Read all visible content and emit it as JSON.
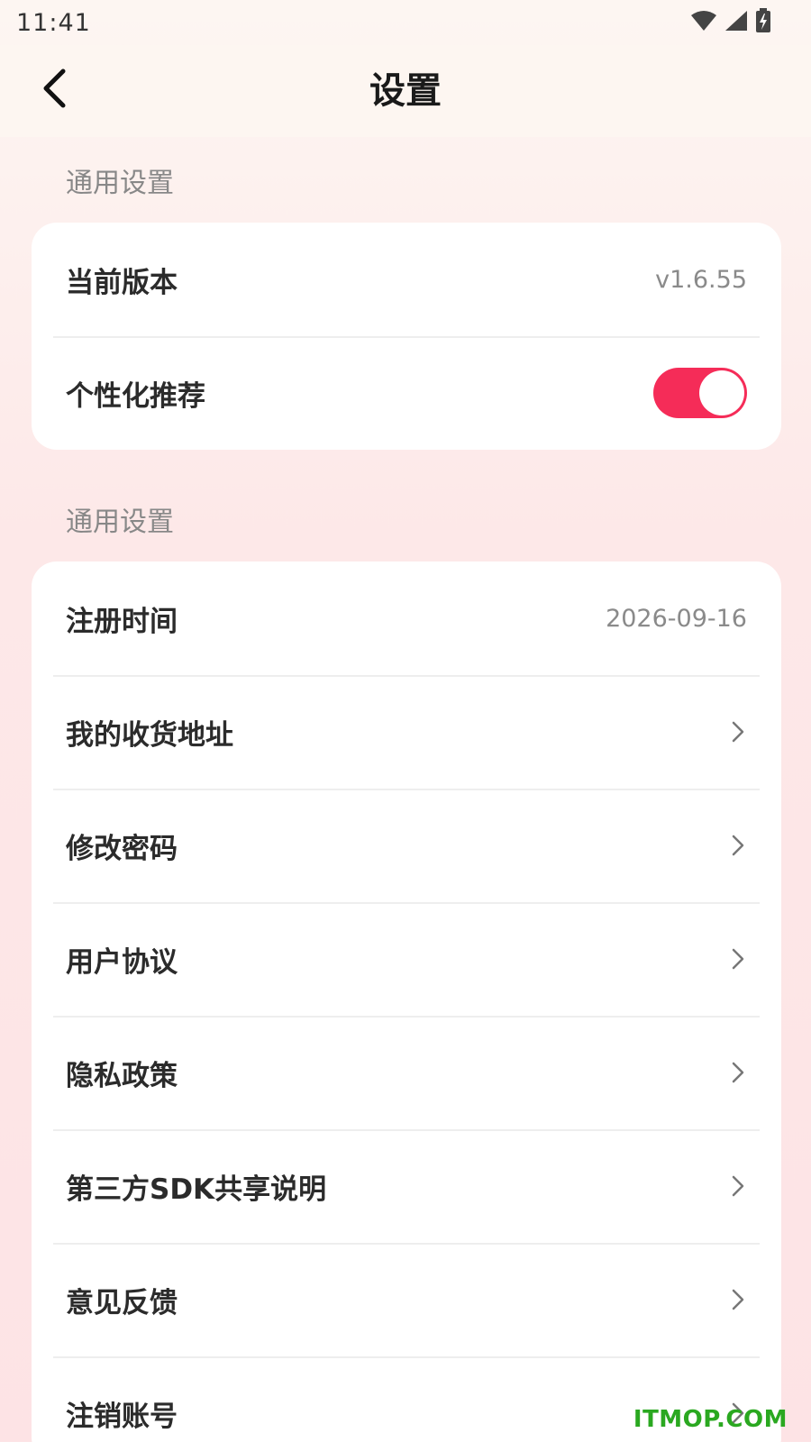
{
  "status_bar": {
    "time": "11:41"
  },
  "header": {
    "title": "设置"
  },
  "section1": {
    "label": "通用设置",
    "rows": [
      {
        "label": "当前版本",
        "value": "v1.6.55"
      },
      {
        "label": "个性化推荐",
        "toggle_on": true
      }
    ]
  },
  "section2": {
    "label": "通用设置",
    "rows": [
      {
        "label": "注册时间",
        "value": "2026-09-16"
      },
      {
        "label": "我的收货地址"
      },
      {
        "label": "修改密码"
      },
      {
        "label": "用户协议"
      },
      {
        "label": "隐私政策"
      },
      {
        "label": "第三方SDK共享说明"
      },
      {
        "label": "意见反馈"
      },
      {
        "label": "注销账号"
      }
    ]
  },
  "watermark": "ITMOP.COM",
  "colors": {
    "accent": "#f52c58",
    "watermark": "#2aa820"
  }
}
